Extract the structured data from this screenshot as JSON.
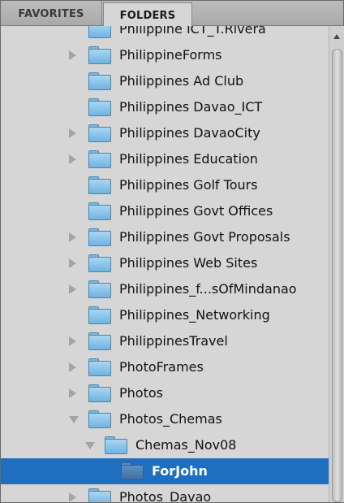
{
  "tabs": {
    "favorites": "FAVORITES",
    "folders": "FOLDERS"
  },
  "rows": [
    {
      "label": "Philippine ICT_T.Rivera",
      "depth": 0,
      "expander": "none"
    },
    {
      "label": "PhilippineForms",
      "depth": 0,
      "expander": "collapsed"
    },
    {
      "label": "Philippines Ad Club",
      "depth": 0,
      "expander": "none"
    },
    {
      "label": "Philippines Davao_ICT",
      "depth": 0,
      "expander": "none"
    },
    {
      "label": "Philippines DavaoCity",
      "depth": 0,
      "expander": "collapsed"
    },
    {
      "label": "Philippines Education",
      "depth": 0,
      "expander": "collapsed"
    },
    {
      "label": "Philippines Golf Tours",
      "depth": 0,
      "expander": "none"
    },
    {
      "label": "Philippines Govt Offices",
      "depth": 0,
      "expander": "none"
    },
    {
      "label": "Philippines Govt Proposals",
      "depth": 0,
      "expander": "collapsed"
    },
    {
      "label": "Philippines Web Sites",
      "depth": 0,
      "expander": "collapsed"
    },
    {
      "label": "Philippines_f...sOfMindanao",
      "depth": 0,
      "expander": "collapsed"
    },
    {
      "label": "Philippines_Networking",
      "depth": 0,
      "expander": "none"
    },
    {
      "label": "PhilippinesTravel",
      "depth": 0,
      "expander": "collapsed"
    },
    {
      "label": "PhotoFrames",
      "depth": 0,
      "expander": "collapsed"
    },
    {
      "label": "Photos",
      "depth": 0,
      "expander": "collapsed"
    },
    {
      "label": "Photos_Chemas",
      "depth": 0,
      "expander": "expanded"
    },
    {
      "label": "Chemas_Nov08",
      "depth": 1,
      "expander": "expanded"
    },
    {
      "label": "ForJohn",
      "depth": 2,
      "expander": "none",
      "selected": true
    },
    {
      "label": "Photos_Davao",
      "depth": 0,
      "expander": "collapsed"
    }
  ],
  "colors": {
    "selection": "#1e6fbf",
    "folder": "#8cc6ec",
    "background": "#d6d6d6"
  },
  "icons": {
    "folder": "folder-icon",
    "expand": "disclosure-triangle-icon",
    "scroll_up": "scroll-up-arrow-icon"
  }
}
